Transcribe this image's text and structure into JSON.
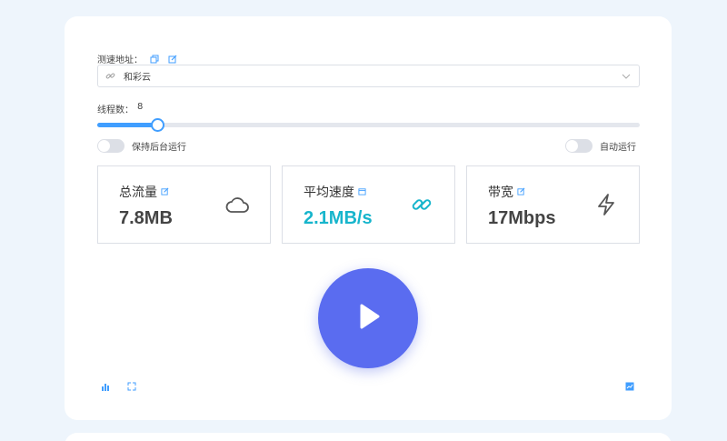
{
  "form": {
    "address_label": "测速地址：",
    "selected_source": "和彩云",
    "threads_label": "线程数：",
    "threads_value": "8",
    "threads_fraction": 0.11
  },
  "switches": {
    "keep_background_label": "保持后台运行",
    "auto_run_label": "自动运行"
  },
  "stats": {
    "total_traffic": {
      "title": "总流量",
      "value": "7.8MB"
    },
    "avg_speed": {
      "title": "平均速度",
      "value": "2.1MB/s"
    },
    "bandwidth": {
      "title": "带宽",
      "value": "17Mbps"
    }
  },
  "colors": {
    "accent": "#409eff",
    "speed_text": "#17b5cc",
    "play_button": "#5a6cf0",
    "background": "#eef5fc"
  },
  "icons": [
    "copy-icon",
    "edit-icon",
    "link-icon",
    "chevron-down-icon",
    "cloud-icon",
    "chain-link-icon",
    "lightning-icon",
    "play-icon",
    "bar-chart-icon",
    "fullscreen-icon",
    "image-chart-icon"
  ]
}
